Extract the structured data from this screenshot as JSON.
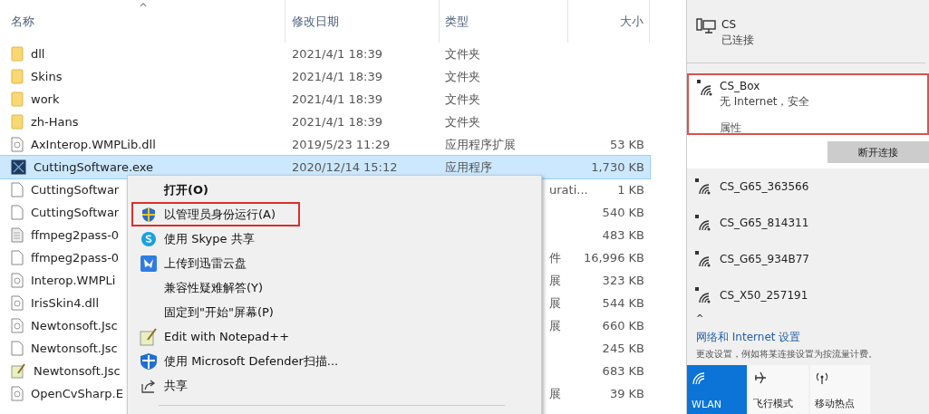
{
  "explorer": {
    "sort_indicator": "^",
    "columns": [
      "名称",
      "修改日期",
      "类型",
      "大小"
    ],
    "rows": [
      {
        "kind": "folder",
        "name": "dll",
        "date": "2021/4/1 18:39",
        "type": "文件夹",
        "size": "",
        "selected": false
      },
      {
        "kind": "folder",
        "name": "Skins",
        "date": "2021/4/1 18:39",
        "type": "文件夹",
        "size": "",
        "selected": false
      },
      {
        "kind": "folder",
        "name": "work",
        "date": "2021/4/1 18:39",
        "type": "文件夹",
        "size": "",
        "selected": false
      },
      {
        "kind": "folder",
        "name": "zh-Hans",
        "date": "2021/4/1 18:39",
        "type": "文件夹",
        "size": "",
        "selected": false
      },
      {
        "kind": "dll",
        "name": "AxInterop.WMPLib.dll",
        "date": "2019/5/23 11:29",
        "type": "应用程序扩展",
        "size": "53 KB",
        "selected": false
      },
      {
        "kind": "exe",
        "name": "CuttingSoftware.exe",
        "date": "2020/12/14 15:12",
        "type": "应用程序",
        "size": "1,730 KB",
        "selected": true
      },
      {
        "kind": "file",
        "name": "CuttingSoftwar",
        "type_tail": "urati...",
        "size": "1 KB",
        "selected": false
      },
      {
        "kind": "file",
        "name": "CuttingSoftwar",
        "size": "540 KB",
        "selected": false
      },
      {
        "kind": "text",
        "name": "ffmpeg2pass-0",
        "size": "483 KB",
        "selected": false
      },
      {
        "kind": "file",
        "name": "ffmpeg2pass-0",
        "type_tail": "件",
        "size": "16,996 KB",
        "selected": false
      },
      {
        "kind": "dll",
        "name": "Interop.WMPLi",
        "type_tail": "展",
        "size": "323 KB",
        "selected": false
      },
      {
        "kind": "dll",
        "name": "IrisSkin4.dll",
        "type_tail": "展",
        "size": "544 KB",
        "selected": false
      },
      {
        "kind": "dll",
        "name": "Newtonsoft.Jsc",
        "type_tail": "展",
        "size": "660 KB",
        "selected": false
      },
      {
        "kind": "file",
        "name": "Newtonsoft.Jsc",
        "size": "245 KB",
        "selected": false
      },
      {
        "kind": "notepad",
        "name": "Newtonsoft.Jsc",
        "size": "683 KB",
        "selected": false
      },
      {
        "kind": "dll",
        "name": "OpenCvSharp.E",
        "type_tail": "展",
        "size": "39 KB",
        "selected": false
      }
    ]
  },
  "context_menu": {
    "items": [
      {
        "kind": "plain",
        "label": "打开(O)",
        "bold": true,
        "highlighted": false
      },
      {
        "kind": "shield",
        "label": "以管理员身份运行(A)",
        "bold": false,
        "highlighted": true
      },
      {
        "kind": "skype",
        "label": "使用 Skype 共享",
        "bold": false,
        "highlighted": false
      },
      {
        "kind": "cloud",
        "label": "上传到迅雷云盘",
        "bold": false,
        "highlighted": false
      },
      {
        "kind": "plain",
        "label": "兼容性疑难解答(Y)",
        "bold": false,
        "highlighted": false
      },
      {
        "kind": "plain",
        "label": "固定到\"开始\"屏幕(P)",
        "bold": false,
        "highlighted": false
      },
      {
        "kind": "notepad",
        "label": "Edit with Notepad++",
        "bold": false,
        "highlighted": false
      },
      {
        "kind": "defender",
        "label": "使用 Microsoft Defender扫描...",
        "bold": false,
        "highlighted": false
      },
      {
        "kind": "share",
        "label": "共享",
        "bold": false,
        "highlighted": false
      }
    ]
  },
  "network_panel": {
    "ethernet": {
      "name": "CS",
      "status": "已连接"
    },
    "connected_wifi": {
      "name": "CS_Box",
      "status": "无 Internet，安全",
      "properties": "属性",
      "highlighted": true,
      "disconnect_button": "断开连接"
    },
    "networks": [
      {
        "name": "CS_G65_363566"
      },
      {
        "name": "CS_G65_814311"
      },
      {
        "name": "CS_G65_934B77"
      },
      {
        "name": "CS_X50_257191"
      }
    ],
    "collapse": "^",
    "settings_link": "网络和 Internet 设置",
    "settings_hint": "更改设置，例如将某连接设置为按流量计费。",
    "tiles": [
      {
        "kind": "wifi",
        "label": "WLAN",
        "on": true
      },
      {
        "kind": "airplane",
        "label": "飞行模式",
        "on": false
      },
      {
        "kind": "hotspot",
        "label": "移动热点",
        "on": false
      }
    ]
  }
}
